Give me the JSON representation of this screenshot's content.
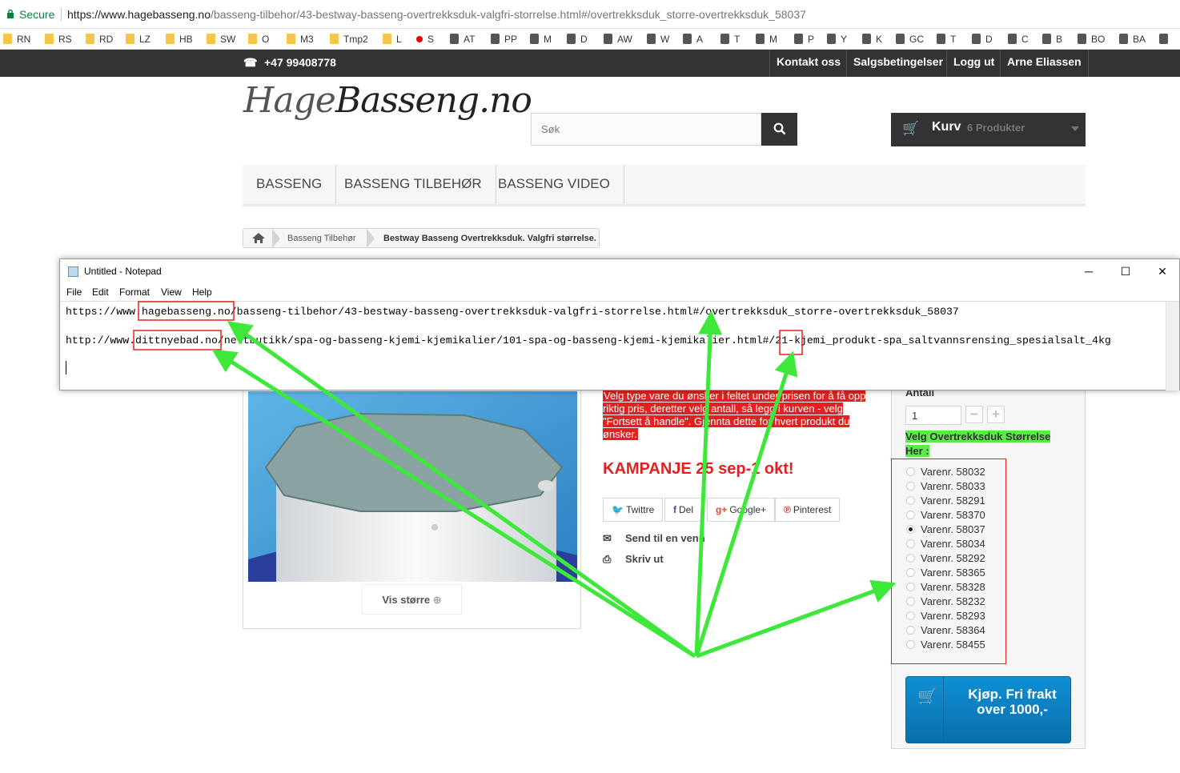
{
  "browser": {
    "secure_label": "Secure",
    "url_domain": "https://www.hagebasseng.no",
    "url_path": "/basseng-tilbehor/43-bestway-basseng-overtrekksduk-valgfri-storrelse.html#/overtrekksduk_storre-overtrekksduk_58037",
    "bookmarks": [
      {
        "label": "RN",
        "icon": "folder-icon"
      },
      {
        "label": "RS",
        "icon": "folder-icon"
      },
      {
        "label": "RD",
        "icon": "folder-icon"
      },
      {
        "label": "LZ",
        "icon": "folder-icon"
      },
      {
        "label": "HB",
        "icon": "folder-icon"
      },
      {
        "label": "SW",
        "icon": "folder-icon"
      },
      {
        "label": "O",
        "icon": "folder-icon"
      },
      {
        "label": "M3",
        "icon": "folder-icon"
      },
      {
        "label": "Tmp2",
        "icon": "folder-icon"
      },
      {
        "label": "L",
        "icon": "folder-icon"
      },
      {
        "label": "S",
        "icon": "red-dot-icon"
      },
      {
        "label": "AT",
        "icon": "gear-icon"
      },
      {
        "label": "PP",
        "icon": "paypal-icon"
      },
      {
        "label": "M",
        "icon": "g-icon"
      },
      {
        "label": "D",
        "icon": "drive-icon"
      },
      {
        "label": "AW",
        "icon": "g-icon"
      },
      {
        "label": "W",
        "icon": "bag-icon"
      },
      {
        "label": "A",
        "icon": "bars-icon"
      },
      {
        "label": "T",
        "icon": "diamond-icon"
      },
      {
        "label": "M",
        "icon": "gmail-icon"
      },
      {
        "label": "P",
        "icon": "pinwheel-icon"
      },
      {
        "label": "Y",
        "icon": "youtube-icon"
      },
      {
        "label": "K",
        "icon": "badge-icon"
      },
      {
        "label": "GC",
        "icon": "calendar-icon"
      },
      {
        "label": "T",
        "icon": "translate-icon"
      },
      {
        "label": "D",
        "icon": "lock-icon"
      },
      {
        "label": "C",
        "icon": "spiral-icon"
      },
      {
        "label": "B",
        "icon": "person-icon"
      },
      {
        "label": "BO",
        "icon": "person-icon"
      },
      {
        "label": "BA",
        "icon": "person-icon"
      },
      {
        "label": "",
        "icon": "k-icon"
      }
    ]
  },
  "topbar": {
    "phone": "+47 99408778",
    "links": [
      "Kontakt oss",
      "Salgsbetingelser",
      "Logg ut",
      "Arne Eliassen"
    ]
  },
  "logo": {
    "part1": "Hage",
    "part2": "Basseng.no"
  },
  "search": {
    "placeholder": "Søk"
  },
  "cart": {
    "label": "Kurv",
    "count": "6 Produkter"
  },
  "menu": [
    "BASSENG",
    "BASSENG TILBEHØR",
    "BASSENG VIDEO"
  ],
  "breadcrumb": {
    "category": "Basseng Tilbehør",
    "current": "Bestway Basseng Overtrekksduk. Valgfri størrelse."
  },
  "product": {
    "vis_storre": "Vis større",
    "note": "Velg type vare du ønsker i feltet under prisen for å få opp riktig pris, deretter velg antall, så legg i kurven - velg \"Fortsett å handle\". Gjennta dette for hvert produkt du ønsker.",
    "kampanje": "KAMPANJE 25 sep-1 okt!",
    "share": [
      "Twittre",
      "Del",
      "Google+",
      "Pinterest"
    ],
    "send_friend": "Send til en venn",
    "print": "Skriv ut"
  },
  "buy": {
    "antall_label": "Antall",
    "qty": "1",
    "variant_label": "Velg Overtrekksduk Størrelse Her :",
    "variants": [
      "Varenr. 58032",
      "Varenr. 58033",
      "Varenr. 58291",
      "Varenr. 58370",
      "Varenr. 58037",
      "Varenr. 58034",
      "Varenr. 58292",
      "Varenr. 58365",
      "Varenr. 58328",
      "Varenr. 58232",
      "Varenr. 58293",
      "Varenr. 58364",
      "Varenr. 58455"
    ],
    "selected_variant": "Varenr. 58037",
    "button": "Kjøp. Fri frakt over 1000,-"
  },
  "notepad": {
    "title": "Untitled - Notepad",
    "menu": [
      "File",
      "Edit",
      "Format",
      "View",
      "Help"
    ],
    "line1": "https://www.hagebasseng.no/basseng-tilbehor/43-bestway-basseng-overtrekksduk-valgfri-storrelse.html#/overtrekksduk_storre-overtrekksduk_58037",
    "line2": "http://www.dittnyebad.no/nettbutikk/spa-og-basseng-kjemi-kjemikalier/101-spa-og-basseng-kjemi-kjemikalier.html#/21-kjemi_produkt-spa_saltvannsrensing_spesialsalt_4kg"
  },
  "colors": {
    "accent_red": "#e52020",
    "highlight_green": "#5bea48",
    "arrow_green": "#3ee83a",
    "buy_blue": "#0f8fd6",
    "topbar": "#333333"
  }
}
